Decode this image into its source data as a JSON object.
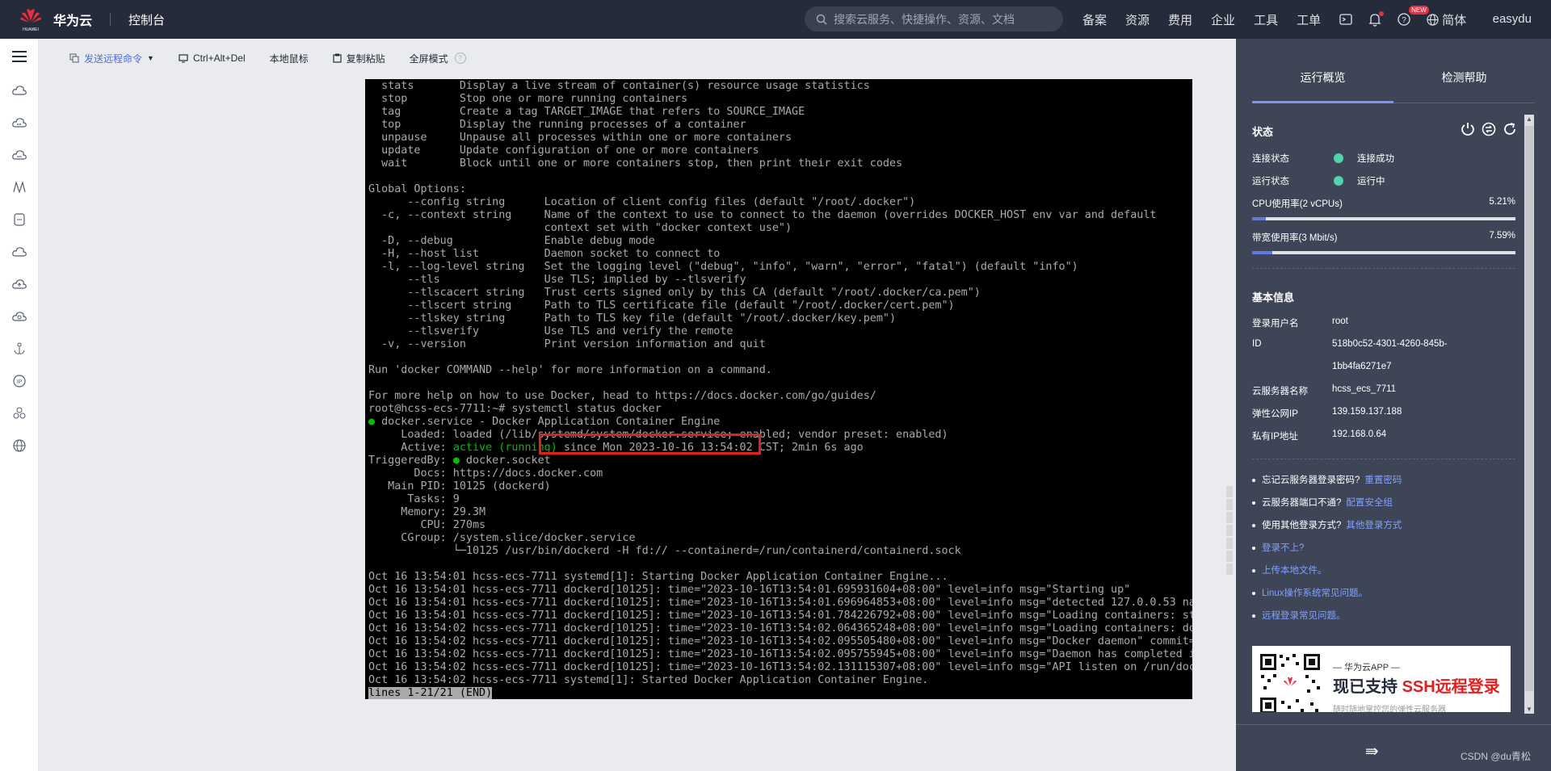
{
  "topbar": {
    "brand": "华为云",
    "brand_sub": "HUAWEI",
    "console": "控制台",
    "search_placeholder": "搜索云服务、快捷操作、资源、文档",
    "menus": [
      "备案",
      "资源",
      "费用",
      "企业",
      "工具",
      "工单"
    ],
    "new_badge": "NEW",
    "lang": "简体",
    "user": "easydu"
  },
  "toolbar": {
    "send_remote": "发送远程命令",
    "ctrl_alt_del": "Ctrl+Alt+Del",
    "local_mouse": "本地鼠标",
    "copy_paste": "复制粘贴",
    "fullscreen": "全屏模式",
    "help": "?"
  },
  "terminal": {
    "lines": [
      "  stats       Display a live stream of container(s) resource usage statistics",
      "  stop        Stop one or more running containers",
      "  tag         Create a tag TARGET_IMAGE that refers to SOURCE_IMAGE",
      "  top         Display the running processes of a container",
      "  unpause     Unpause all processes within one or more containers",
      "  update      Update configuration of one or more containers",
      "  wait        Block until one or more containers stop, then print their exit codes",
      "",
      "Global Options:",
      "      --config string      Location of client config files (default \"/root/.docker\")",
      "  -c, --context string     Name of the context to use to connect to the daemon (overrides DOCKER_HOST env var and default",
      "                           context set with \"docker context use\")",
      "  -D, --debug              Enable debug mode",
      "  -H, --host list          Daemon socket to connect to",
      "  -l, --log-level string   Set the logging level (\"debug\", \"info\", \"warn\", \"error\", \"fatal\") (default \"info\")",
      "      --tls                Use TLS; implied by --tlsverify",
      "      --tlscacert string   Trust certs signed only by this CA (default \"/root/.docker/ca.pem\")",
      "      --tlscert string     Path to TLS certificate file (default \"/root/.docker/cert.pem\")",
      "      --tlskey string      Path to TLS key file (default \"/root/.docker/key.pem\")",
      "      --tlsverify          Use TLS and verify the remote",
      "  -v, --version            Print version information and quit",
      "",
      "Run 'docker COMMAND --help' for more information on a command.",
      "",
      "For more help on how to use Docker, head to https://docs.docker.com/go/guides/",
      "root@hcss-ecs-7711:~# systemctl status docker",
      "● docker.service - Docker Application Container Engine",
      "     Loaded: loaded (/lib/systemd/system/docker.service; enabled; vendor preset: enabled)",
      "     Active: active (running) since Mon 2023-10-16 13:54:02 CST; 2min 6s ago",
      "TriggeredBy: ● docker.socket",
      "       Docs: https://docs.docker.com",
      "   Main PID: 10125 (dockerd)",
      "      Tasks: 9",
      "     Memory: 29.3M",
      "        CPU: 270ms",
      "     CGroup: /system.slice/docker.service",
      "             └─10125 /usr/bin/dockerd -H fd:// --containerd=/run/containerd/containerd.sock",
      "",
      "Oct 16 13:54:01 hcss-ecs-7711 systemd[1]: Starting Docker Application Container Engine...",
      "Oct 16 13:54:01 hcss-ecs-7711 dockerd[10125]: time=\"2023-10-16T13:54:01.695931604+08:00\" level=info msg=\"Starting up\"",
      "Oct 16 13:54:01 hcss-ecs-7711 dockerd[10125]: time=\"2023-10-16T13:54:01.696964853+08:00\" level=info msg=\"detected 127.0.0.53 na",
      "Oct 16 13:54:01 hcss-ecs-7711 dockerd[10125]: time=\"2023-10-16T13:54:01.784226792+08:00\" level=info msg=\"Loading containers: st",
      "Oct 16 13:54:02 hcss-ecs-7711 dockerd[10125]: time=\"2023-10-16T13:54:02.064365248+08:00\" level=info msg=\"Loading containers: do",
      "Oct 16 13:54:02 hcss-ecs-7711 dockerd[10125]: time=\"2023-10-16T13:54:02.095505480+08:00\" level=info msg=\"Docker daemon\" commit=",
      "Oct 16 13:54:02 hcss-ecs-7711 dockerd[10125]: time=\"2023-10-16T13:54:02.095755945+08:00\" level=info msg=\"Daemon has completed i",
      "Oct 16 13:54:02 hcss-ecs-7711 dockerd[10125]: time=\"2023-10-16T13:54:02.131115307+08:00\" level=info msg=\"API listen on /run/doc",
      "Oct 16 13:54:02 hcss-ecs-7711 systemd[1]: Started Docker Application Container Engine."
    ],
    "pager_status": "lines 1-21/21 (END)"
  },
  "panel": {
    "tab_overview": "运行概览",
    "tab_help": "检测帮助",
    "status_title": "状态",
    "conn_label": "连接状态",
    "conn_value": "连接成功",
    "run_label": "运行状态",
    "run_value": "运行中",
    "cpu_label": "CPU使用率(2 vCPUs)",
    "cpu_pct": "5.21%",
    "cpu_fraction": 0.0521,
    "bw_label": "带宽使用率(3 Mbit/s)",
    "bw_pct": "7.59%",
    "bw_fraction": 0.0759,
    "basic_title": "基本信息",
    "login_user_label": "登录用户名",
    "login_user": "root",
    "id_label": "ID",
    "id_line1": "518b0c52-4301-4260-845b-",
    "id_line2": "1bb4fa6271e7",
    "server_name_label": "云服务器名称",
    "server_name": "hcss_ecs_7711",
    "eip_label": "弹性公网IP",
    "eip": "139.159.137.188",
    "private_ip_label": "私有IP地址",
    "private_ip": "192.168.0.64",
    "links": [
      {
        "text": "忘记云服务器登录密码?",
        "link": "重置密码"
      },
      {
        "text": "云服务器端口不通?",
        "link": "配置安全组"
      },
      {
        "text": "使用其他登录方式?",
        "link": "其他登录方式"
      },
      {
        "text": "",
        "link": "登录不上?"
      },
      {
        "text": "",
        "link": "上传本地文件。"
      },
      {
        "text": "",
        "link": "Linux操作系统常见问题。"
      },
      {
        "text": "",
        "link": "远程登录常见问题。"
      }
    ],
    "promo_line1": "— 华为云APP —",
    "promo_line2a": "现已支持 ",
    "promo_line2b": "SSH远程登录",
    "promo_line3": "随时随地掌控您的弹性云服务器",
    "credit": "CSDN @du青松"
  },
  "colors": {
    "topbar_bg": "#252b3a",
    "panel_bg": "#3e4556",
    "accent": "#5e7ce0",
    "status_green": "#50d4ab",
    "highlight_red": "#e02020"
  }
}
